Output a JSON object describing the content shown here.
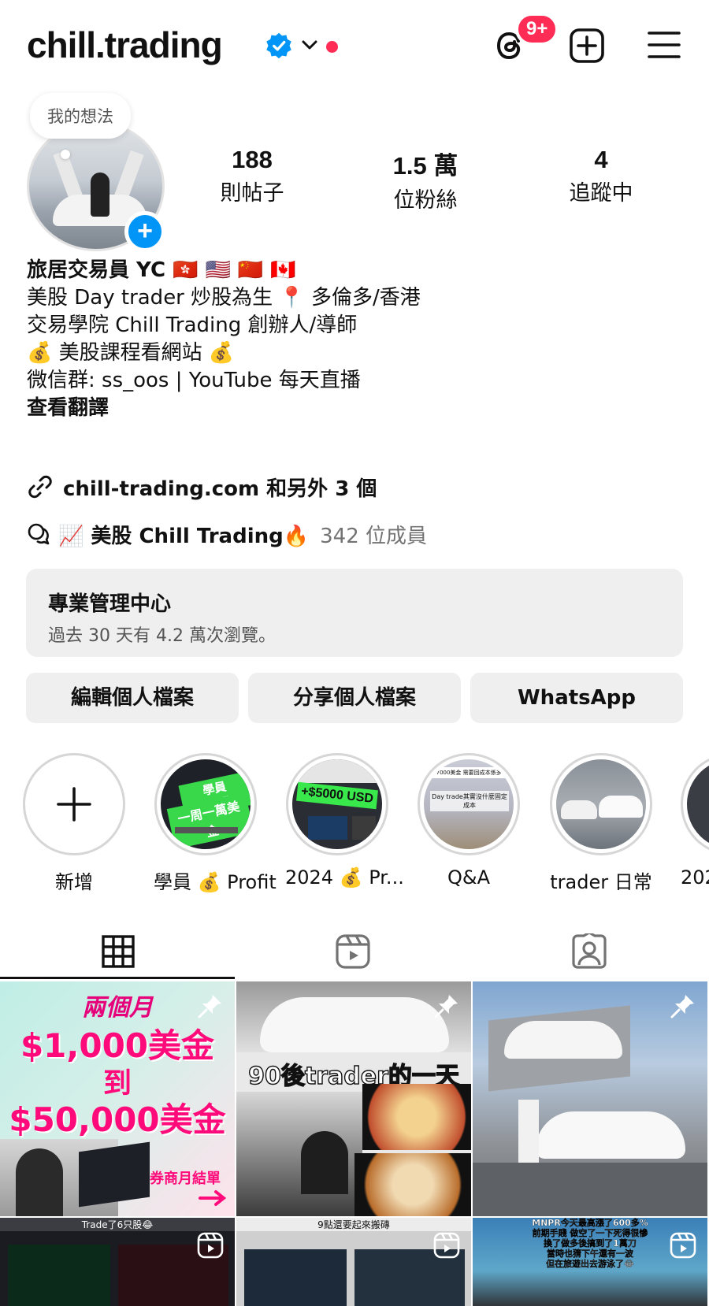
{
  "header": {
    "username": "chill.trading",
    "threads_badge": "9+"
  },
  "avatar": {
    "note": "我的想法"
  },
  "stats": [
    {
      "num": "188",
      "label": "則帖子"
    },
    {
      "num": "1.5 萬",
      "label": "位粉絲"
    },
    {
      "num": "4",
      "label": "追蹤中"
    }
  ],
  "bio": {
    "name": "旅居交易員 YC 🇭🇰 🇺🇸 🇨🇳 🇨🇦",
    "line1": "美股 Day trader 炒股為生 📍 多倫多/香港",
    "line2": "交易學院 Chill Trading 創辦人/導師",
    "line3": "💰 美股課程看網站 💰",
    "line4": "微信群: ss_oos | YouTube 每天直播",
    "translate": "查看翻譯"
  },
  "link": {
    "text": "chill-trading.com 和另外 3 個"
  },
  "channel": {
    "name": "📈 美股 Chill Trading🔥",
    "members": "342 位成員"
  },
  "pro_dashboard": {
    "title": "專業管理中心",
    "subtitle": "過去 30 天有 4.2 萬次瀏覽。"
  },
  "buttons": {
    "edit": "編輯個人檔案",
    "share": "分享個人檔案",
    "whatsapp": "WhatsApp"
  },
  "highlights": [
    {
      "label": "新增"
    },
    {
      "label": "學員 💰 Profit",
      "img_text1": "學員profit",
      "img_text2": "一周一萬美金"
    },
    {
      "label": "2024 💰 Pr...",
      "img_text1": "+$5000 USD"
    },
    {
      "label": "Q&A",
      "img_text1": "7000美金 需要回成本係多?",
      "img_text2": "Day trade其實沒什麼固定成本"
    },
    {
      "label": "trader 日常"
    },
    {
      "label": "202"
    }
  ],
  "posts": [
    {
      "line1": "兩個月",
      "line2": "$1,000美金",
      "line3": "到",
      "line4": "$50,000美金",
      "caption": "券商月結單"
    },
    {
      "overlay": "90後trader的一天"
    },
    {},
    {
      "top": "Trade了6只股😂"
    },
    {
      "top": "9點還要起來搬磚"
    },
    {
      "top": "MNPR今天最高漲了600多%",
      "top2": "前期手賤 做空了一下死得很慘",
      "top3": "換了做多後搞到了1萬刀",
      "top4": "當時也猜下午還有一波",
      "top5": "但在旅遊出去游泳了😂"
    }
  ],
  "colors": {
    "accent_blue": "#0095f6",
    "badge_red": "#ff2d55",
    "button_gray": "#efefef"
  }
}
